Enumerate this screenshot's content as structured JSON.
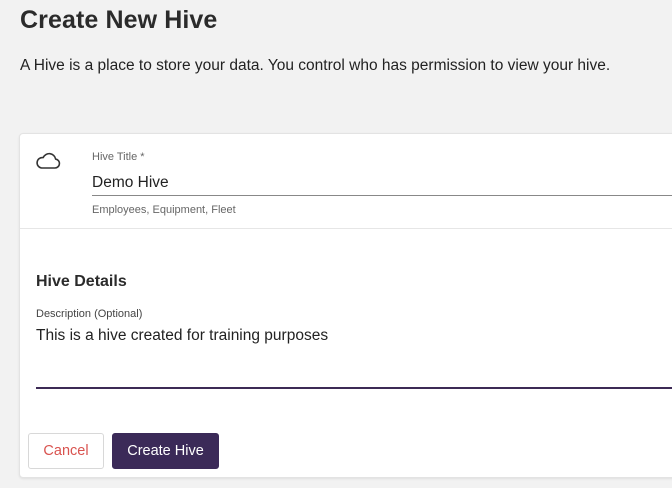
{
  "page": {
    "title": "Create New Hive",
    "description": "A Hive is a place to store your data. You control who has permission to view your hive."
  },
  "form": {
    "icon": "cloud-icon",
    "hive_title": {
      "label": "Hive Title *",
      "value": "Demo Hive",
      "hint": "Employees, Equipment, Fleet"
    },
    "details_section_title": "Hive Details",
    "description_field": {
      "label": "Description (Optional)",
      "value": "This is a hive created for training purposes"
    }
  },
  "actions": {
    "cancel_label": "Cancel",
    "create_label": "Create Hive"
  },
  "colors": {
    "primary": "#3b2a58",
    "cancel_text": "#d9534f",
    "background": "#f2f2f2"
  }
}
